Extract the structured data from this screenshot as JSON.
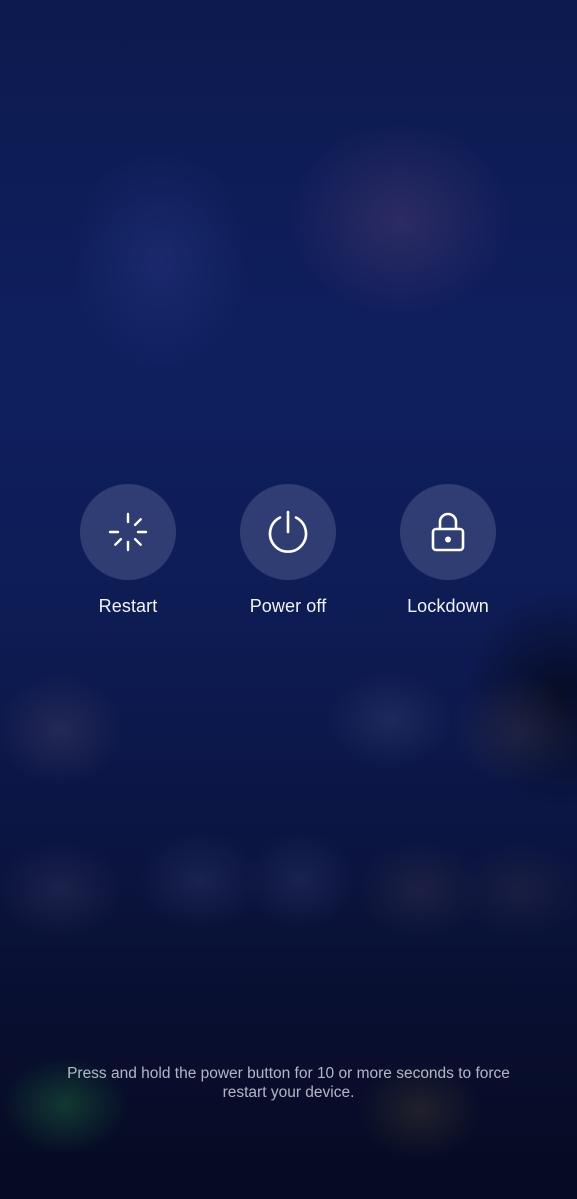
{
  "actions": {
    "restart": {
      "label": "Restart",
      "icon": "restart-icon"
    },
    "power_off": {
      "label": "Power off",
      "icon": "power-icon"
    },
    "lockdown": {
      "label": "Lockdown",
      "icon": "lock-icon"
    }
  },
  "hint": {
    "line1": "Press and hold the power button for 10 or more seconds to force",
    "line2": "restart your device."
  },
  "colors": {
    "background": "#0e1c56",
    "button_circle": "#4c5584",
    "label_text": "#f2f3f7"
  }
}
